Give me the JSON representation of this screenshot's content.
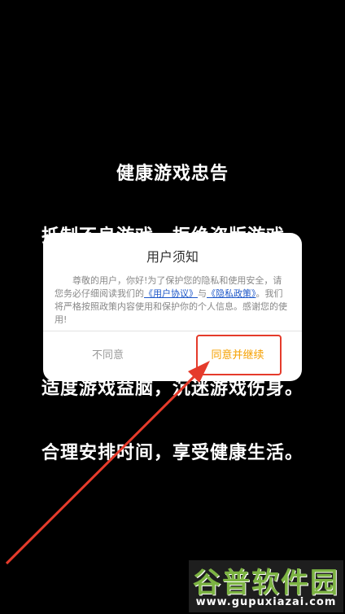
{
  "notice": {
    "lines": [
      "健康游戏忠告",
      "抵制不良游戏，拒绝盗版游戏。",
      "适度游戏益脑，沉迷游戏伤身。",
      "合理安排时间，享受健康生活。"
    ]
  },
  "dialog": {
    "title": "用户须知",
    "body_part1": "尊敬的用户，你好!为了保护您的隐私和使用安全，请您务必仔细阅读我们的",
    "link_user_agreement": "《用户协议》",
    "body_and": "与",
    "link_privacy_policy": "《隐私政策》",
    "body_part2": "。我们将严格按照政策内容使用和保护你的个人信息。感谢您的使用!",
    "disagree_label": "不同意",
    "agree_label": "同意并继续",
    "agree_color": "#f5a000"
  },
  "annotation": {
    "color": "#e53b2b"
  },
  "watermark": {
    "title": "谷普软件园",
    "url": "www.gupuxiazai.com"
  }
}
